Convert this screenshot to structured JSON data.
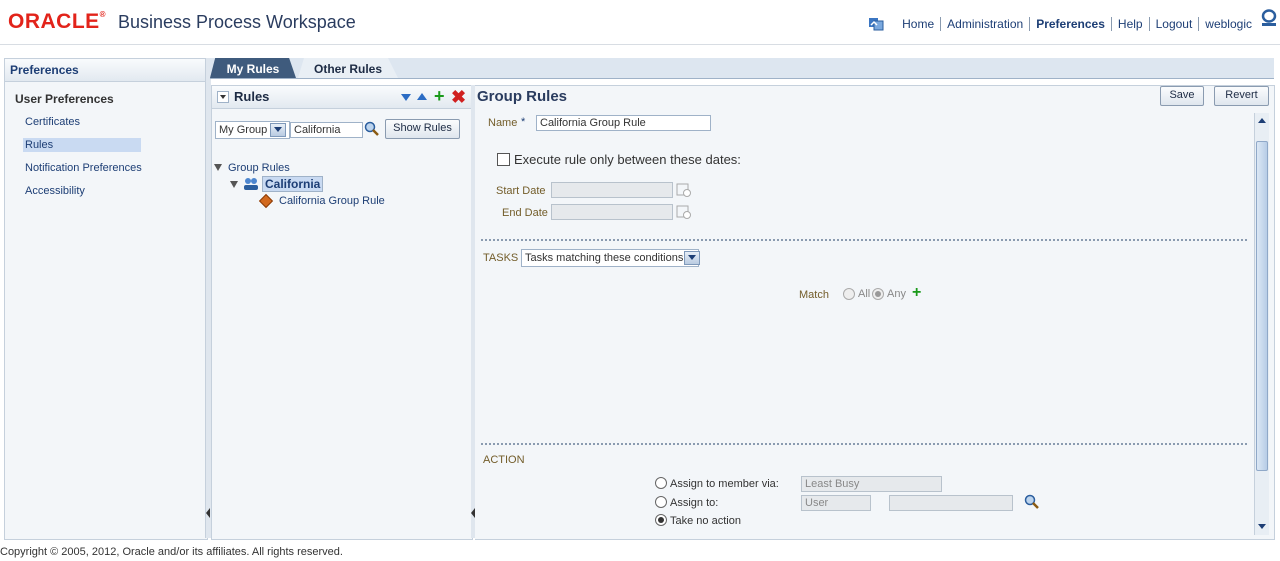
{
  "header": {
    "logo": "ORACLE",
    "title": "Business Process Workspace",
    "nav": [
      "Home",
      "Administration",
      "Preferences",
      "Help",
      "Logout",
      "weblogic"
    ]
  },
  "left": {
    "title": "Preferences",
    "section": "User Preferences",
    "items": [
      "Certificates",
      "Rules",
      "Notification Preferences",
      "Accessibility"
    ]
  },
  "tabs": [
    "My Rules",
    "Other Rules"
  ],
  "rules": {
    "title": "Rules",
    "scope_select": "My Group",
    "filter_value": "California",
    "show_button": "Show Rules",
    "tree_root": "Group Rules",
    "tree_group": "California",
    "tree_rule": "California Group Rule"
  },
  "form": {
    "title": "Group Rules",
    "save": "Save",
    "revert": "Revert",
    "name_label": "Name",
    "required_mark": "*",
    "name_value": "California Group Rule",
    "date_checkbox_label": "Execute rule only between these dates:",
    "start_date_label": "Start Date",
    "end_date_label": "End Date",
    "tasks_label": "TASKS",
    "tasks_select": "Tasks matching these conditions",
    "match_label": "Match",
    "match_all": "All",
    "match_any": "Any",
    "action_label": "ACTION",
    "assign_member": "Assign to member via:",
    "assign_member_select": "Least Busy",
    "assign_to": "Assign to:",
    "assign_to_select": "User",
    "no_action": "Take no action"
  },
  "footer": "Copyright © 2005, 2012, Oracle and/or its affiliates. All rights reserved."
}
